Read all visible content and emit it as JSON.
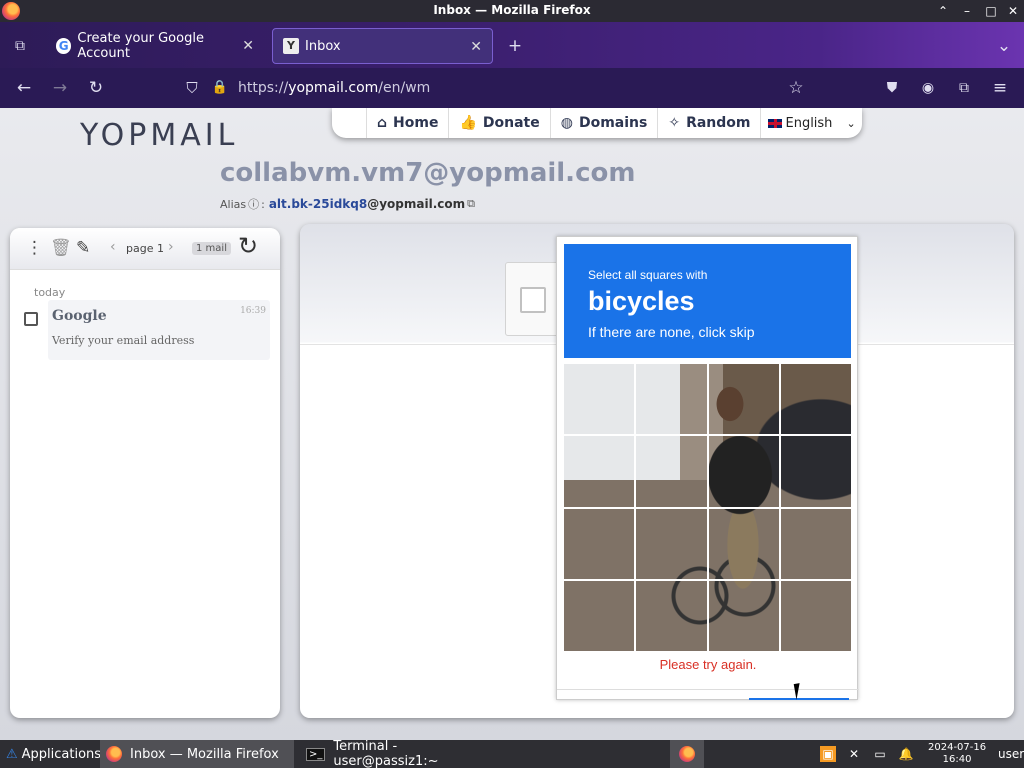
{
  "window": {
    "title": "Inbox — Mozilla Firefox",
    "controls": {
      "chevron": "⌃",
      "minimize": "–",
      "maximize": "□",
      "close": "✕"
    }
  },
  "tabs": [
    {
      "label": "Create your Google Account",
      "icon": "google-icon",
      "active": false
    },
    {
      "label": "Inbox",
      "icon": "yopmail-icon",
      "active": true
    }
  ],
  "tab_glyphs": {
    "google": "G",
    "yopmail": "Y",
    "close": "✕",
    "new_tab": "+",
    "list_all": "⌄",
    "overflow": "⧉"
  },
  "navbar": {
    "url_scheme": "https://",
    "url_host": "yopmail.com",
    "url_path": "/en/wm",
    "glyphs": {
      "back": "←",
      "forward": "→",
      "reload": "↻",
      "shield": "⛉",
      "lock": "🔒",
      "star": "☆",
      "pocket": "⛊",
      "account": "◉",
      "extensions": "⧉",
      "menu": "≡"
    }
  },
  "site": {
    "logo": "YOPMAIL",
    "menu": [
      {
        "label": "Home",
        "icon": "home-icon",
        "glyph": "⌂"
      },
      {
        "label": "Donate",
        "icon": "thumbs-up-icon",
        "glyph": "👍"
      },
      {
        "label": "Domains",
        "icon": "globe-icon",
        "glyph": "◍"
      },
      {
        "label": "Random",
        "icon": "magic-wand-icon",
        "glyph": "✧"
      }
    ],
    "language": "English",
    "language_caret": "⌄",
    "email": "collabvm.vm7@yopmail.com",
    "alias_label": "Alias",
    "alias_info": "ⓘ",
    "alias_sep": ":",
    "alias_value": "alt.bk-25idkq8",
    "alias_domain": "@yopmail.com",
    "alias_copy": "⧉"
  },
  "inbox": {
    "toolbar_glyphs": {
      "more": "⋮",
      "trash": "🗑",
      "edit": "✎",
      "prev": "‹",
      "next": "›",
      "refresh": "↻"
    },
    "page_label": "page 1",
    "mail_count": "1 mail",
    "day_label": "today",
    "mails": [
      {
        "from": "Google",
        "subject": "Verify your email address",
        "time": "16:39"
      }
    ]
  },
  "captcha": {
    "instruction_line1": "Select all squares with",
    "target": "bicycles",
    "instruction_line2": "If there are none, click skip",
    "error": "Please try again.",
    "grid_size": 4
  },
  "taskbar": {
    "apps_label": "Applications",
    "apps_glyph": "⚠",
    "firefox_label": "Inbox — Mozilla Firefox",
    "terminal_label": "Terminal - user@passiz1:~",
    "terminal_glyph": ">_",
    "tray_glyphs": {
      "notes": "▣",
      "network": "✕",
      "battery": "▭",
      "bell": "🔔"
    },
    "clock_date": "2024-07-16",
    "clock_time": "16:40",
    "user": "user"
  },
  "colors": {
    "captcha_blue": "#1a73e8",
    "error_red": "#d93025",
    "tab_gradient_start": "#2d1b57",
    "tab_gradient_end": "#6b34b0"
  }
}
